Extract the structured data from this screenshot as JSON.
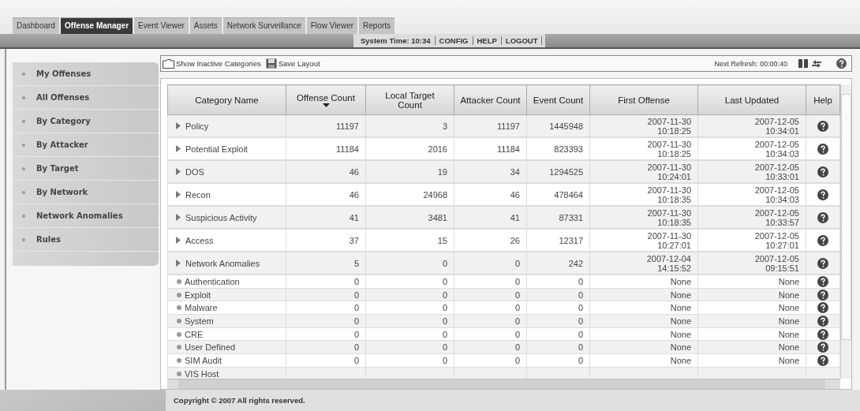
{
  "tabs": [
    {
      "label": "Dashboard",
      "selected": false
    },
    {
      "label": "Offense Manager",
      "selected": true
    },
    {
      "label": "Event Viewer",
      "selected": false
    },
    {
      "label": "Assets",
      "selected": false
    },
    {
      "label": "Network Surveillance",
      "selected": false
    },
    {
      "label": "Flow Viewer",
      "selected": false
    },
    {
      "label": "Reports",
      "selected": false
    }
  ],
  "system_time": "System Time: 10:34",
  "header_links": [
    "CONFIG",
    "HELP",
    "LOGOUT"
  ],
  "sidebar": {
    "items": [
      {
        "label": "My Offenses",
        "selected": false
      },
      {
        "label": "All Offenses",
        "selected": false
      },
      {
        "label": "By Category",
        "selected": false
      },
      {
        "label": "By Attacker",
        "selected": false
      },
      {
        "label": "By Target",
        "selected": false
      },
      {
        "label": "By Network",
        "selected": false
      },
      {
        "label": "Network Anomalies",
        "selected": false
      },
      {
        "label": "Rules",
        "selected": false
      }
    ]
  },
  "toolbar": {
    "buttons": [
      {
        "kind": "folder",
        "label": "Show Inactive Categories"
      },
      {
        "kind": "save",
        "label": "Save Layout"
      }
    ],
    "refresh": "Next Refresh: 00:00:40"
  },
  "table": {
    "columns": [
      {
        "label": "Category Name",
        "sorted": false
      },
      {
        "label": "Offense Count",
        "sorted": true
      },
      {
        "label": "Local Target Count",
        "sorted": false
      },
      {
        "label": "Attacker Count",
        "sorted": false
      },
      {
        "label": "Event Count",
        "sorted": false
      },
      {
        "label": "First Offense",
        "sorted": false
      },
      {
        "label": "Last Updated",
        "sorted": false
      },
      {
        "label": "Help",
        "sorted": false
      }
    ],
    "rows": [
      {
        "kind": "category",
        "cells": [
          "Policy",
          "11197",
          "3",
          "11197",
          "1445948",
          "2007-11-30 10:18:25",
          "2007-12-05 10:34:01"
        ]
      },
      {
        "kind": "category",
        "cells": [
          "Potential Exploit",
          "11184",
          "2016",
          "11184",
          "823393",
          "2007-11-30 10:18:25",
          "2007-12-05 10:34:03"
        ]
      },
      {
        "kind": "category",
        "cells": [
          "DOS",
          "46",
          "19",
          "34",
          "1294525",
          "2007-11-30 10:24:01",
          "2007-12-05 10:33:01"
        ]
      },
      {
        "kind": "category",
        "cells": [
          "Recon",
          "46",
          "24968",
          "46",
          "478464",
          "2007-11-30 10:18:35",
          "2007-12-05 10:34:03"
        ]
      },
      {
        "kind": "category",
        "cells": [
          "Suspicious Activity",
          "41",
          "3481",
          "41",
          "87331",
          "2007-11-30 10:18:35",
          "2007-12-05 10:33:57"
        ]
      },
      {
        "kind": "category",
        "cells": [
          "Access",
          "37",
          "15",
          "26",
          "12317",
          "2007-11-30 10:27:01",
          "2007-12-05 10:27:01"
        ]
      },
      {
        "kind": "category",
        "cells": [
          "Network Anomalies",
          "5",
          "0",
          "0",
          "242",
          "2007-12-04 14:15:52",
          "2007-12-05 09:15:51"
        ]
      },
      {
        "kind": "subcategory",
        "cells": [
          "Authentication",
          "0",
          "0",
          "0",
          "0",
          "None",
          "None"
        ]
      },
      {
        "kind": "subcategory",
        "cells": [
          "Exploit",
          "0",
          "0",
          "0",
          "0",
          "None",
          "None"
        ]
      },
      {
        "kind": "subcategory",
        "cells": [
          "Malware",
          "0",
          "0",
          "0",
          "0",
          "None",
          "None"
        ]
      },
      {
        "kind": "subcategory",
        "cells": [
          "System",
          "0",
          "0",
          "0",
          "0",
          "None",
          "None"
        ]
      },
      {
        "kind": "subcategory",
        "cells": [
          "CRE",
          "0",
          "0",
          "0",
          "0",
          "None",
          "None"
        ]
      },
      {
        "kind": "subcategory",
        "cells": [
          "User Defined",
          "0",
          "0",
          "0",
          "0",
          "None",
          "None"
        ]
      },
      {
        "kind": "subcategory",
        "cells": [
          "SIM Audit",
          "0",
          "0",
          "0",
          "0",
          "None",
          "None"
        ]
      },
      {
        "kind": "subcategory",
        "cells": [
          "VIS Host"
        ]
      }
    ]
  },
  "footer": "Copyright © 2007 All rights reserved."
}
